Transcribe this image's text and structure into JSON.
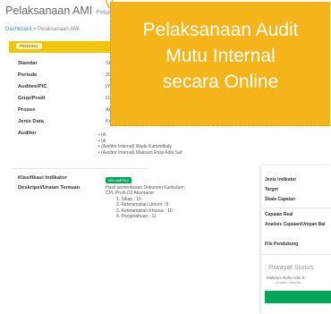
{
  "app": {
    "title": "Pelaksanaan AMI",
    "subtitle": "Pelaksanaan",
    "breadcrumb": [
      "Dashboard",
      "Pelaksanaan AMI"
    ]
  },
  "overlay": {
    "lines": [
      "Pelaksanaan Audit",
      "Mutu Internal",
      "secara Online"
    ],
    "color": "#f5b41a"
  },
  "status": {
    "badge": "PENDING",
    "color": "#f1c40f"
  },
  "details": [
    {
      "label": "Standar",
      "value": "Standi"
    },
    {
      "label": "Periode",
      "value": "2019"
    },
    {
      "label": "Auditee/PIC",
      "value": "[YEP]"
    },
    {
      "label": "Grup/Prodi",
      "value": "D3-Ak"
    },
    {
      "label": "Proses",
      "value": "Akade"
    },
    {
      "label": "Jenis Data",
      "value": "Kuant"
    },
    {
      "label": "Auditor",
      "value": ""
    }
  ],
  "auditors": [
    "• (A",
    "• (A",
    "• (Auditor Internal) Wade Kamindkaly",
    "• (Auditor Internal) Maksum Rolis Adin Saf"
  ],
  "klasifikasi": {
    "label": "Klasifikasi Indikator",
    "badge": "MELAMPAUI"
  },
  "deskripsi": {
    "label": "Deskripsi/Uraian Temuan",
    "lines": [
      "Hasil pemeriksaan Dokumen Kurikulum:",
      "CPL Prodi D3 Akuntansi:",
      "1. Sikap : 10",
      "2. Keterampilan Umum : 9",
      "3. Keterampilan Khusus : 10",
      "4. Pengetahuan : 11"
    ]
  },
  "right_panel": {
    "labels": [
      "Jenis Indikator",
      "Target",
      "Skala Capaian",
      "Capaian Real",
      "Analisis Capaian/Umpan Bal",
      "File Pendukung"
    ],
    "riwayat": "Riwayat Status",
    "person_name": "Maksum Rolis Adin S",
    "person_role": "(Auditor Internal)"
  }
}
